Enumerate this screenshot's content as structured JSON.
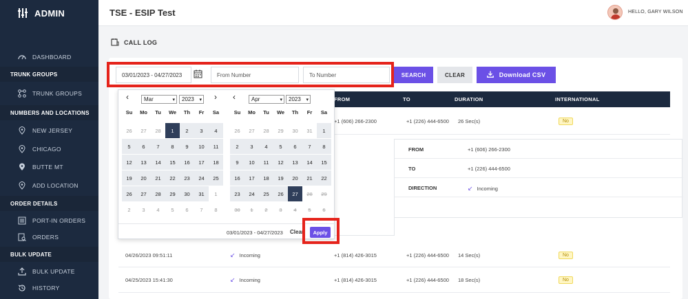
{
  "sidebar": {
    "brand": "ADMIN",
    "items": {
      "dashboard": "DASHBOARD",
      "trunk_groups": "TRUNK GROUPS",
      "new_jersey": "NEW JERSEY",
      "chicago": "CHICAGO",
      "butte_mt": "BUTTE MT",
      "add_location": "ADD LOCATION",
      "port_in_orders": "PORT-IN ORDERS",
      "orders": "ORDERS",
      "bulk_update": "BULK UPDATE",
      "history": "HISTORY"
    },
    "sections": {
      "trunk_groups": "TRUNK GROUPS",
      "numbers_locations": "NUMBERS AND LOCATIONS",
      "order_details": "ORDER DETAILS",
      "bulk_update": "BULK UPDATE"
    }
  },
  "topbar": {
    "title": "TSE - ESIP Test",
    "greeting": "HELLO, GARY WILSON"
  },
  "page": {
    "title": "CALL LOG"
  },
  "filters": {
    "date_range": "03/01/2023 - 04/27/2023",
    "from_placeholder": "From Number",
    "to_placeholder": "To Number",
    "search_label": "SEARCH",
    "clear_label": "CLEAR",
    "download_label": "Download CSV"
  },
  "table": {
    "headers": {
      "from": "FROM",
      "to": "TO",
      "duration": "DURATION",
      "international": "INTERNATIONAL"
    },
    "rows": [
      {
        "date": "",
        "direction": "",
        "from": "+1 (606) 266-2300",
        "to": "+1 (226) 444-6500",
        "duration": "26 Sec(s)",
        "international": "No"
      },
      {
        "date": "04/26/2023 09:51:11",
        "direction": "Incoming",
        "from": "+1 (814) 426-3015",
        "to": "+1 (226) 444-6500",
        "duration": "14 Sec(s)",
        "international": "No"
      },
      {
        "date": "04/25/2023 15:41:30",
        "direction": "Incoming",
        "from": "+1 (814) 426-3015",
        "to": "+1 (226) 444-6500",
        "duration": "18 Sec(s)",
        "international": "No"
      }
    ],
    "details": {
      "from_label": "FROM",
      "from_value": "+1 (606) 266-2300",
      "to_label": "TO",
      "to_value": "+1 (226) 444-6500",
      "direction_label": "DIRECTION",
      "direction_value": "Incoming"
    }
  },
  "calendar": {
    "left": {
      "month": "Mar",
      "year": "2023"
    },
    "right": {
      "month": "Apr",
      "year": "2023"
    },
    "weekdays": [
      "Su",
      "Mo",
      "Tu",
      "We",
      "Th",
      "Fr",
      "Sa"
    ],
    "left_days": [
      [
        "26",
        "27",
        "28",
        "1",
        "2",
        "3",
        "4"
      ],
      [
        "5",
        "6",
        "7",
        "8",
        "9",
        "10",
        "11"
      ],
      [
        "12",
        "13",
        "14",
        "15",
        "16",
        "17",
        "18"
      ],
      [
        "19",
        "20",
        "21",
        "22",
        "23",
        "24",
        "25"
      ],
      [
        "26",
        "27",
        "28",
        "29",
        "30",
        "31",
        "1"
      ],
      [
        "2",
        "3",
        "4",
        "5",
        "6",
        "7",
        "8"
      ]
    ],
    "right_days": [
      [
        "26",
        "27",
        "28",
        "29",
        "30",
        "31",
        "1"
      ],
      [
        "2",
        "3",
        "4",
        "5",
        "6",
        "7",
        "8"
      ],
      [
        "9",
        "10",
        "11",
        "12",
        "13",
        "14",
        "15"
      ],
      [
        "16",
        "17",
        "18",
        "19",
        "20",
        "21",
        "22"
      ],
      [
        "23",
        "24",
        "25",
        "26",
        "27",
        "28",
        "29"
      ],
      [
        "30",
        "1",
        "2",
        "3",
        "4",
        "5",
        "6"
      ]
    ],
    "range_text": "03/01/2023 - 04/27/2023",
    "clear_label": "Clear",
    "apply_label": "Apply"
  }
}
